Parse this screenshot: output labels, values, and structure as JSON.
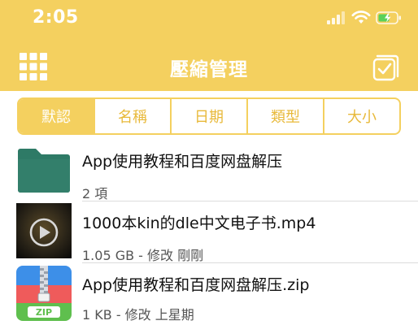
{
  "status": {
    "time": "2:05"
  },
  "header": {
    "title": "壓縮管理"
  },
  "sort_tabs": [
    {
      "label": "默認",
      "active": true
    },
    {
      "label": "名稱",
      "active": false
    },
    {
      "label": "日期",
      "active": false
    },
    {
      "label": "類型",
      "active": false
    },
    {
      "label": "大小",
      "active": false
    }
  ],
  "files": [
    {
      "name": "App使用教程和百度网盘解压",
      "meta": "2 項",
      "icon": "folder-icon"
    },
    {
      "name": "1000本kin的dle中文电子书.mp4",
      "meta": "1.05 GB - 修改 剛剛",
      "icon": "video-play-icon"
    },
    {
      "name": "App使用教程和百度网盘解压.zip",
      "meta": "1 KB - 修改 上星期",
      "icon": "zip-archive-icon",
      "badge": "ZIP"
    }
  ],
  "colors": {
    "accent": "#f4d05f",
    "folder": "#2e7a66"
  }
}
